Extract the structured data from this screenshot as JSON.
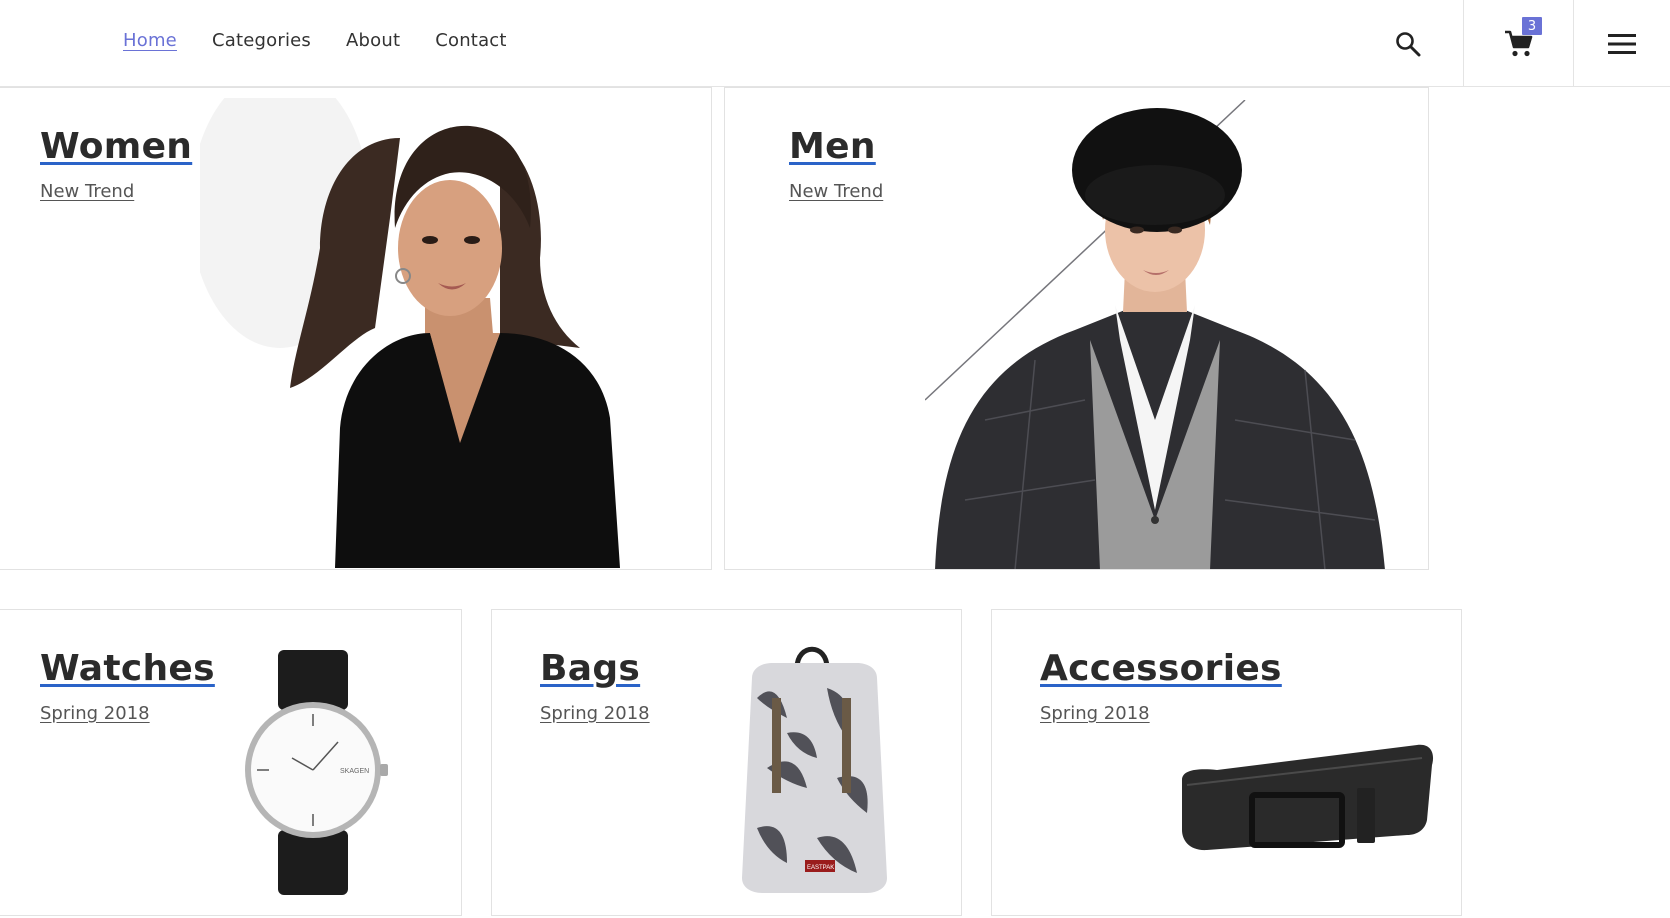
{
  "nav": {
    "items": [
      {
        "label": "Home",
        "active": true
      },
      {
        "label": "Categories"
      },
      {
        "label": "About"
      },
      {
        "label": "Contact"
      }
    ]
  },
  "header": {
    "cart_count": "3",
    "icons": [
      "search-icon",
      "cart-icon",
      "menu-icon"
    ]
  },
  "categories": [
    {
      "title": "Women",
      "subtitle": "New Trend"
    },
    {
      "title": "Men",
      "subtitle": "New Trend"
    },
    {
      "title": "Watches",
      "subtitle": "Spring 2018"
    },
    {
      "title": "Bags",
      "subtitle": "Spring 2018"
    },
    {
      "title": "Accessories",
      "subtitle": "Spring 2018"
    }
  ],
  "product_text": {
    "watch_brand": "SKAGEN",
    "bag_brand": "EASTPAK"
  },
  "colors": {
    "accent": "#6a72d6",
    "title_underline": "#2a63c8",
    "text": "#2b2b2b"
  }
}
